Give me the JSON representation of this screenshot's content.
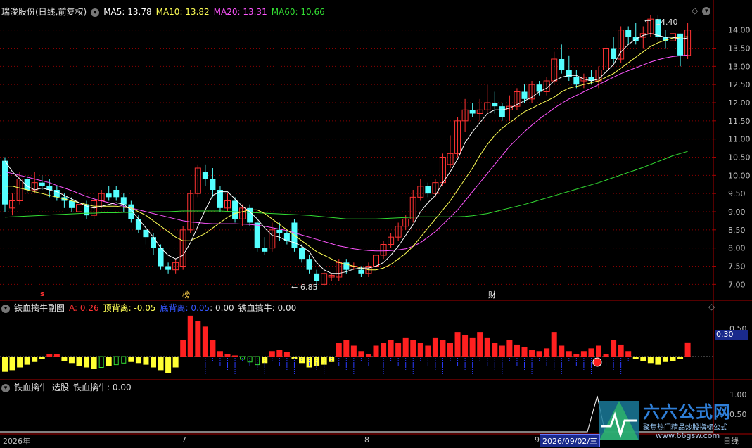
{
  "panel_main": {
    "stock": "瑞浚股份(日线,前复权)",
    "ma5": "MA5: 13.78",
    "ma10": "MA10: 13.82",
    "ma20": "MA20: 13.31",
    "ma60": "MA60: 10.66",
    "high_label": "14.40",
    "low_label": "6.85",
    "markers": {
      "s": "s",
      "bang": "榜",
      "cai": "财"
    }
  },
  "panel_sub1": {
    "title": "铁血擒牛副图",
    "a": "A: 0.26",
    "top_div": "顶背离: -0.05",
    "bot_div": "底背离: 0.05",
    "bot_div_val": ": 0.00",
    "niu": "铁血擒牛: 0.00",
    "tick_050": "0.50",
    "readout": "0.30"
  },
  "panel_sub2": {
    "title": "铁血擒牛_选股",
    "niu": "铁血擒牛: 0.00",
    "tick_100": "1.00",
    "tick_050": "0.50"
  },
  "bottom": {
    "year": "2026年",
    "m7": "7",
    "m8": "8",
    "m9": "9",
    "date": "2026/09/02/三",
    "period": "日线"
  },
  "watermark": {
    "brand": "六六公式网",
    "slogan": "聚焦热门精品炒股指标公式",
    "url": "www.66gsw.com"
  },
  "colors": {
    "up": "#ff3232",
    "down": "#54ffff",
    "ma5": "#ffffff",
    "ma10": "#ffff55",
    "ma20": "#ff55ff",
    "ma60": "#33dd33",
    "grid": "#8a0000"
  },
  "chart_data": [
    {
      "type": "candlestick",
      "title": "瑞浚股份(日线,前复权)",
      "ylim": [
        6.6,
        14.4
      ],
      "yticks": [
        "14.00",
        "13.50",
        "13.00",
        "12.50",
        "12.00",
        "11.50",
        "11.00",
        "10.50",
        "10.00",
        "9.50",
        "9.00",
        "8.50",
        "8.00",
        "7.50",
        "7.00"
      ],
      "ohlc": [
        [
          10.4,
          10.5,
          9.0,
          9.2
        ],
        [
          9.1,
          9.5,
          8.9,
          9.3
        ],
        [
          9.3,
          10.1,
          9.2,
          9.9
        ],
        [
          9.9,
          10.0,
          9.5,
          9.6
        ],
        [
          9.6,
          10.1,
          9.5,
          9.8
        ],
        [
          9.8,
          10.0,
          9.6,
          9.7
        ],
        [
          9.7,
          9.9,
          9.4,
          9.6
        ],
        [
          9.6,
          9.7,
          9.3,
          9.4
        ],
        [
          9.4,
          9.5,
          9.1,
          9.3
        ],
        [
          9.3,
          9.4,
          9.0,
          9.1
        ],
        [
          9.0,
          9.3,
          8.8,
          9.2
        ],
        [
          9.2,
          9.3,
          8.8,
          8.9
        ],
        [
          8.9,
          9.4,
          8.8,
          9.3
        ],
        [
          9.3,
          9.6,
          9.1,
          9.5
        ],
        [
          9.5,
          9.7,
          9.3,
          9.4
        ],
        [
          9.6,
          9.7,
          9.3,
          9.4
        ],
        [
          9.4,
          9.5,
          9.0,
          9.2
        ],
        [
          9.2,
          9.3,
          8.7,
          8.8
        ],
        [
          8.8,
          8.9,
          8.4,
          8.5
        ],
        [
          8.5,
          8.6,
          8.1,
          8.3
        ],
        [
          8.3,
          8.4,
          7.8,
          8.0
        ],
        [
          8.0,
          8.1,
          7.4,
          7.5
        ],
        [
          7.5,
          7.6,
          7.3,
          7.4
        ],
        [
          7.4,
          7.7,
          7.3,
          7.6
        ],
        [
          7.5,
          8.6,
          7.4,
          8.5
        ],
        [
          8.5,
          9.6,
          8.4,
          9.5
        ],
        [
          9.5,
          10.3,
          9.4,
          10.2
        ],
        [
          10.1,
          10.3,
          9.7,
          9.9
        ],
        [
          9.9,
          10.2,
          9.4,
          9.6
        ],
        [
          9.6,
          9.7,
          9.0,
          9.1
        ],
        [
          9.1,
          9.5,
          9.0,
          9.3
        ],
        [
          9.3,
          9.4,
          8.7,
          8.8
        ],
        [
          8.8,
          9.2,
          8.6,
          9.1
        ],
        [
          9.1,
          9.2,
          8.6,
          8.7
        ],
        [
          8.7,
          8.8,
          7.9,
          8.0
        ],
        [
          8.0,
          8.3,
          7.8,
          7.9
        ],
        [
          8.0,
          8.7,
          7.9,
          8.5
        ],
        [
          8.5,
          8.7,
          8.2,
          8.4
        ],
        [
          8.4,
          8.5,
          8.1,
          8.2
        ],
        [
          8.7,
          8.8,
          7.9,
          8.0
        ],
        [
          8.0,
          8.1,
          7.6,
          7.7
        ],
        [
          7.7,
          7.8,
          7.3,
          7.4
        ],
        [
          7.3,
          7.4,
          6.85,
          7.1
        ],
        [
          7.0,
          7.4,
          6.95,
          7.3
        ],
        [
          7.2,
          7.3,
          7.1,
          7.25
        ],
        [
          7.2,
          7.7,
          7.1,
          7.6
        ],
        [
          7.6,
          7.7,
          7.3,
          7.4
        ],
        [
          7.5,
          7.6,
          7.4,
          7.5
        ],
        [
          7.4,
          7.5,
          7.2,
          7.3
        ],
        [
          7.3,
          7.6,
          7.2,
          7.5
        ],
        [
          7.5,
          7.9,
          7.4,
          7.8
        ],
        [
          7.8,
          8.2,
          7.7,
          8.1
        ],
        [
          8.1,
          8.4,
          8.0,
          8.3
        ],
        [
          8.3,
          8.7,
          8.2,
          8.6
        ],
        [
          8.6,
          8.9,
          8.5,
          8.8
        ],
        [
          8.8,
          9.6,
          8.7,
          9.4
        ],
        [
          9.4,
          9.9,
          9.3,
          9.7
        ],
        [
          9.7,
          9.8,
          9.4,
          9.5
        ],
        [
          9.5,
          9.9,
          9.4,
          9.8
        ],
        [
          9.8,
          10.6,
          9.7,
          10.5
        ],
        [
          10.3,
          11.1,
          10.2,
          10.6
        ],
        [
          10.6,
          11.6,
          10.5,
          11.5
        ],
        [
          11.5,
          12.1,
          11.2,
          11.8
        ],
        [
          11.8,
          12.0,
          11.6,
          11.7
        ],
        [
          11.7,
          12.1,
          11.5,
          11.8
        ],
        [
          11.8,
          12.5,
          11.7,
          12.0
        ],
        [
          12.0,
          12.3,
          11.7,
          11.9
        ],
        [
          11.9,
          12.0,
          11.5,
          11.6
        ],
        [
          11.8,
          12.2,
          11.5,
          11.9
        ],
        [
          11.9,
          12.4,
          11.8,
          12.3
        ],
        [
          12.3,
          12.5,
          12.0,
          12.1
        ],
        [
          12.1,
          12.6,
          12.0,
          12.5
        ],
        [
          12.5,
          12.6,
          12.2,
          12.3
        ],
        [
          12.3,
          12.7,
          12.2,
          12.6
        ],
        [
          12.6,
          13.4,
          12.5,
          13.2
        ],
        [
          13.2,
          13.6,
          12.8,
          12.9
        ],
        [
          12.9,
          13.3,
          12.6,
          12.7
        ],
        [
          12.7,
          12.9,
          12.4,
          12.5
        ],
        [
          12.6,
          12.8,
          12.4,
          12.7
        ],
        [
          12.7,
          12.9,
          12.5,
          12.6
        ],
        [
          12.6,
          13.0,
          12.4,
          12.9
        ],
        [
          12.9,
          13.6,
          12.8,
          13.5
        ],
        [
          13.5,
          13.8,
          13.1,
          13.2
        ],
        [
          13.2,
          14.1,
          13.1,
          14.0
        ],
        [
          14.0,
          14.1,
          13.6,
          13.8
        ],
        [
          13.8,
          14.2,
          13.6,
          13.7
        ],
        [
          13.8,
          14.1,
          13.5,
          13.9
        ],
        [
          13.9,
          14.4,
          13.8,
          14.3
        ],
        [
          14.3,
          14.4,
          13.7,
          13.8
        ],
        [
          13.8,
          14.0,
          13.5,
          13.7
        ],
        [
          13.7,
          14.1,
          13.6,
          13.9
        ],
        [
          13.9,
          13.9,
          13.0,
          13.3
        ],
        [
          13.3,
          14.2,
          13.2,
          14.0
        ]
      ],
      "ma5": [
        10.4,
        10.1,
        9.9,
        9.7,
        9.6,
        9.65,
        9.6,
        9.55,
        9.45,
        9.35,
        9.25,
        9.15,
        9.1,
        9.15,
        9.2,
        9.25,
        9.2,
        9.05,
        8.8,
        8.55,
        8.3,
        8.0,
        7.8,
        7.7,
        7.8,
        8.15,
        8.6,
        9.05,
        9.45,
        9.55,
        9.55,
        9.35,
        9.15,
        9.0,
        8.8,
        8.55,
        8.35,
        8.3,
        8.2,
        8.15,
        8.05,
        7.9,
        7.6,
        7.4,
        7.3,
        7.3,
        7.35,
        7.42,
        7.45,
        7.45,
        7.5,
        7.6,
        7.8,
        8.05,
        8.35,
        8.65,
        9.0,
        9.25,
        9.45,
        9.8,
        10.1,
        10.45,
        10.9,
        11.2,
        11.45,
        11.7,
        11.8,
        11.8,
        11.85,
        11.95,
        12.05,
        12.15,
        12.3,
        12.4,
        12.6,
        12.7,
        12.75,
        12.75,
        12.65,
        12.6,
        12.65,
        12.85,
        13.05,
        13.4,
        13.6,
        13.75,
        13.85,
        13.9,
        13.85,
        13.8,
        13.8,
        13.75,
        13.78
      ],
      "ma10": [
        9.7,
        9.7,
        9.65,
        9.6,
        9.55,
        9.5,
        9.45,
        9.4,
        9.35,
        9.3,
        9.25,
        9.2,
        9.15,
        9.15,
        9.15,
        9.15,
        9.12,
        9.1,
        9.0,
        8.9,
        8.75,
        8.6,
        8.45,
        8.3,
        8.2,
        8.2,
        8.3,
        8.4,
        8.55,
        8.7,
        8.85,
        8.95,
        9.0,
        9.05,
        9.05,
        8.95,
        8.8,
        8.65,
        8.5,
        8.35,
        8.2,
        8.05,
        7.9,
        7.8,
        7.7,
        7.6,
        7.55,
        7.5,
        7.45,
        7.4,
        7.4,
        7.45,
        7.55,
        7.7,
        7.85,
        8.05,
        8.3,
        8.55,
        8.8,
        9.05,
        9.3,
        9.6,
        9.9,
        10.2,
        10.55,
        10.85,
        11.1,
        11.3,
        11.45,
        11.6,
        11.75,
        11.85,
        11.95,
        12.05,
        12.15,
        12.3,
        12.4,
        12.45,
        12.5,
        12.55,
        12.6,
        12.7,
        12.8,
        12.95,
        13.1,
        13.25,
        13.4,
        13.55,
        13.65,
        13.72,
        13.78,
        13.8,
        13.82
      ],
      "ma20": [
        10.1,
        10.05,
        10.0,
        9.95,
        9.9,
        9.85,
        9.8,
        9.72,
        9.65,
        9.58,
        9.5,
        9.42,
        9.35,
        9.3,
        9.25,
        9.2,
        9.15,
        9.1,
        9.05,
        9.0,
        8.95,
        8.9,
        8.85,
        8.8,
        8.75,
        8.72,
        8.7,
        8.68,
        8.67,
        8.67,
        8.67,
        8.67,
        8.66,
        8.65,
        8.63,
        8.6,
        8.56,
        8.52,
        8.48,
        8.42,
        8.36,
        8.3,
        8.24,
        8.18,
        8.12,
        8.06,
        8.02,
        7.98,
        7.95,
        7.93,
        7.92,
        7.92,
        7.93,
        7.95,
        7.98,
        8.05,
        8.15,
        8.3,
        8.45,
        8.65,
        8.85,
        9.05,
        9.3,
        9.55,
        9.8,
        10.05,
        10.3,
        10.55,
        10.8,
        11.0,
        11.2,
        11.38,
        11.55,
        11.7,
        11.85,
        11.98,
        12.1,
        12.2,
        12.3,
        12.4,
        12.5,
        12.6,
        12.7,
        12.8,
        12.88,
        12.96,
        13.04,
        13.12,
        13.18,
        13.23,
        13.27,
        13.29,
        13.31
      ],
      "ma60": [
        8.85,
        8.86,
        8.87,
        8.88,
        8.89,
        8.9,
        8.91,
        8.92,
        8.93,
        8.94,
        8.95,
        8.96,
        8.96,
        8.97,
        8.97,
        8.97,
        8.98,
        8.98,
        8.99,
        8.99,
        9.0,
        9.0,
        9.0,
        9.01,
        9.02,
        9.02,
        9.02,
        9.02,
        9.02,
        9.02,
        9.01,
        9.0,
        8.99,
        8.98,
        8.97,
        8.96,
        8.95,
        8.94,
        8.93,
        8.92,
        8.91,
        8.9,
        8.88,
        8.86,
        8.84,
        8.82,
        8.8,
        8.8,
        8.8,
        8.8,
        8.8,
        8.81,
        8.82,
        8.83,
        8.84,
        8.85,
        8.86,
        8.86,
        8.86,
        8.86,
        8.86,
        8.86,
        8.87,
        8.89,
        8.92,
        8.95,
        9.0,
        9.05,
        9.1,
        9.15,
        9.2,
        9.26,
        9.32,
        9.38,
        9.44,
        9.5,
        9.56,
        9.62,
        9.68,
        9.74,
        9.8,
        9.87,
        9.94,
        10.01,
        10.08,
        10.15,
        10.22,
        10.3,
        10.38,
        10.46,
        10.54,
        10.6,
        10.66
      ]
    },
    {
      "type": "bar",
      "title": "铁血擒牛副图",
      "ylim": [
        -0.55,
        0.8
      ],
      "values": [
        -0.28,
        -0.25,
        -0.2,
        -0.15,
        -0.1,
        -0.05,
        0.05,
        0.05,
        -0.08,
        -0.12,
        -0.18,
        -0.2,
        -0.22,
        -0.2,
        -0.18,
        -0.15,
        -0.12,
        -0.1,
        -0.12,
        -0.15,
        -0.2,
        -0.25,
        -0.3,
        -0.2,
        0.3,
        0.75,
        0.65,
        0.55,
        0.3,
        0.1,
        0.05,
        0.02,
        -0.05,
        -0.1,
        -0.15,
        -0.12,
        0.1,
        0.12,
        0.08,
        -0.05,
        -0.12,
        -0.2,
        -0.18,
        -0.15,
        -0.1,
        0.25,
        0.3,
        0.2,
        0.1,
        0.05,
        0.2,
        0.25,
        0.3,
        0.25,
        0.35,
        0.3,
        0.25,
        0.2,
        0.35,
        0.3,
        0.25,
        0.45,
        0.4,
        0.35,
        0.45,
        0.35,
        0.25,
        0.2,
        0.3,
        0.22,
        0.18,
        0.12,
        0.1,
        0.15,
        0.45,
        0.2,
        0.1,
        0.05,
        0.1,
        0.15,
        0.2,
        0.05,
        0.3,
        0.22,
        0.1,
        -0.05,
        -0.08,
        -0.12,
        -0.15,
        -0.1,
        -0.08,
        -0.05,
        0.26
      ],
      "colors": [
        "y",
        "y",
        "y",
        "y",
        "y",
        "y",
        "r",
        "r",
        "y",
        "y",
        "y",
        "y",
        "y",
        "g",
        "y",
        "g",
        "g",
        "y",
        "y",
        "y",
        "y",
        "y",
        "y",
        "y",
        "r",
        "r",
        "r",
        "r",
        "r",
        "r",
        "r",
        "r",
        "g",
        "g",
        "g",
        "y",
        "r",
        "r",
        "r",
        "y",
        "y",
        "y",
        "y",
        "y",
        "y",
        "r",
        "r",
        "r",
        "r",
        "r",
        "r",
        "r",
        "r",
        "r",
        "r",
        "r",
        "r",
        "r",
        "r",
        "r",
        "r",
        "r",
        "r",
        "r",
        "r",
        "r",
        "r",
        "r",
        "r",
        "r",
        "r",
        "r",
        "r",
        "r",
        "r",
        "r",
        "r",
        "r",
        "r",
        "r",
        "r",
        "r",
        "r",
        "r",
        "r",
        "y",
        "y",
        "y",
        "y",
        "y",
        "y",
        "y",
        "r"
      ]
    }
  ]
}
